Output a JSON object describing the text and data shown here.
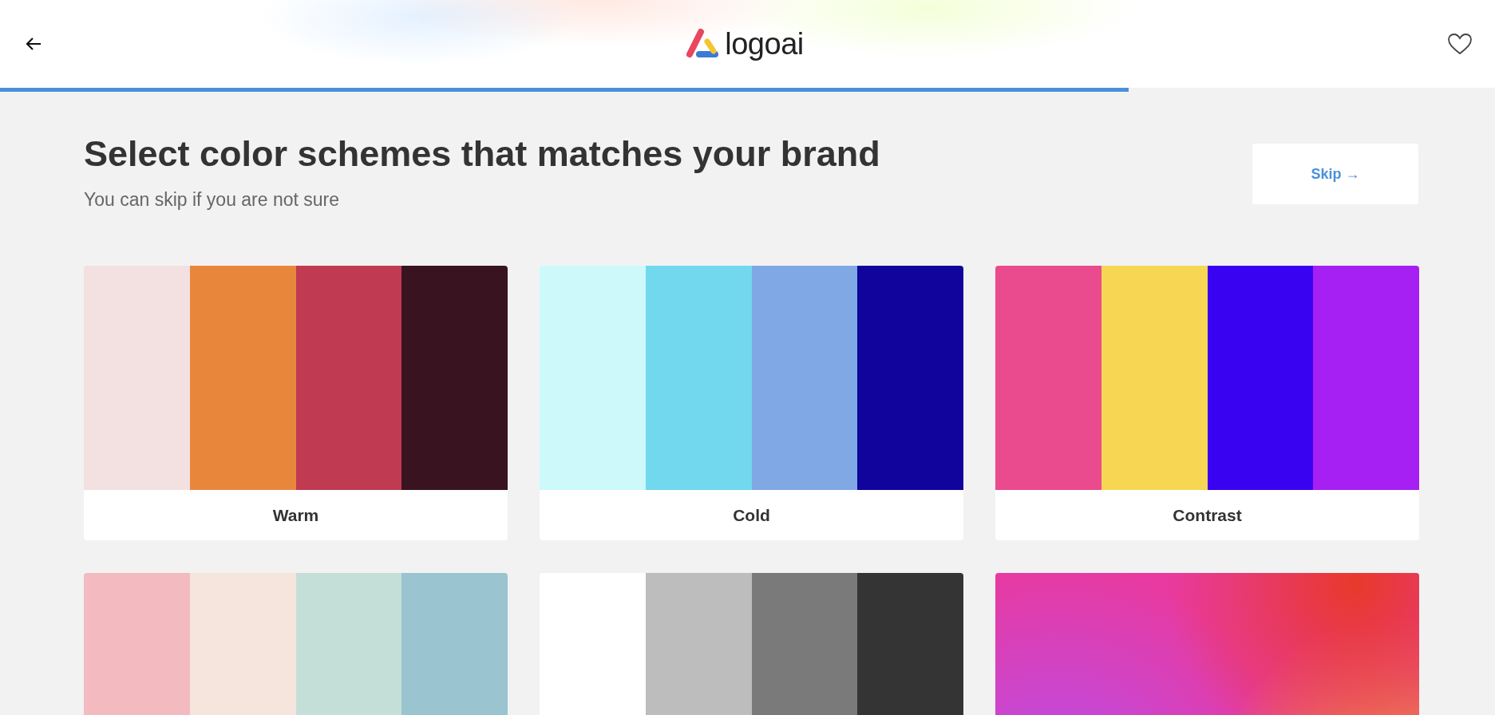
{
  "header": {
    "logo_text": "logoai"
  },
  "progress": {
    "level": 0.755
  },
  "heading": {
    "title": "Select color schemes that matches your brand",
    "subtitle": "You can skip if you are not sure"
  },
  "skip_button": {
    "label": "Skip",
    "arrow": "→"
  },
  "schemes": [
    {
      "kind": "swatches",
      "label": "Warm",
      "swatches": [
        {
          "color": "#f3e0e1"
        },
        {
          "color": "#e8873c"
        },
        {
          "color": "#c03a52"
        },
        {
          "color": "#391320"
        }
      ]
    },
    {
      "kind": "swatches",
      "label": "Cold",
      "swatches": [
        {
          "color": "#cdf9fa"
        },
        {
          "color": "#72d8ee"
        },
        {
          "color": "#7fa8e4"
        },
        {
          "color": "#10049d"
        }
      ]
    },
    {
      "kind": "swatches",
      "label": "Contrast",
      "swatches": [
        {
          "color": "#ea4b8e"
        },
        {
          "color": "#f7d654"
        },
        {
          "color": "#3903f2"
        },
        {
          "color": "#a61ff3"
        }
      ]
    },
    {
      "kind": "swatches",
      "swatches": [
        {
          "color": "#f3bbc0"
        },
        {
          "color": "#f5e5dd"
        },
        {
          "color": "#c4dfd8"
        },
        {
          "color": "#99c4d0"
        }
      ]
    },
    {
      "kind": "swatches",
      "swatches": [
        {
          "color": "#ffffff"
        },
        {
          "color": "#bdbdbd"
        },
        {
          "color": "#7a7a7a"
        },
        {
          "color": "#343434"
        }
      ]
    },
    {
      "kind": "gradient"
    }
  ]
}
